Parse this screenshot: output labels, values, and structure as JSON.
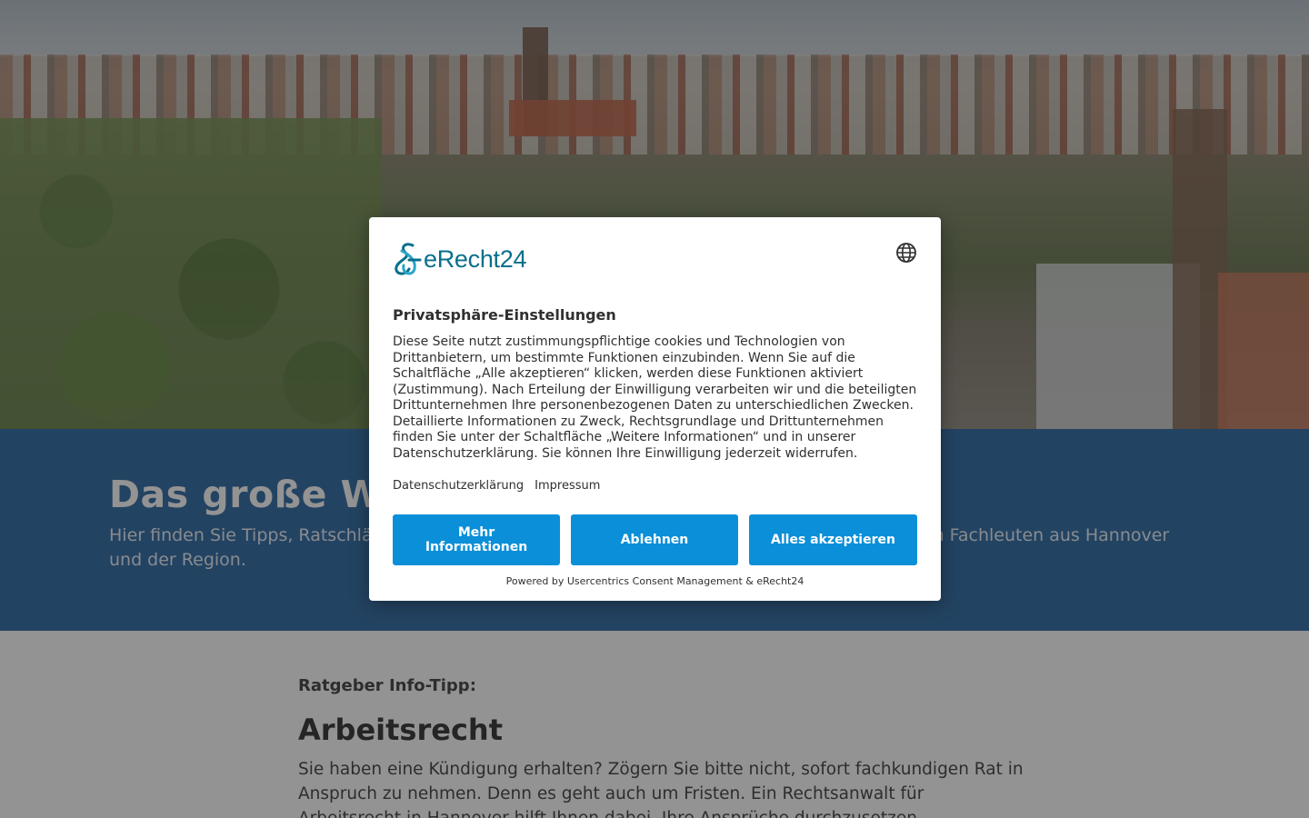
{
  "hero": {
    "image_description": "aerial city view"
  },
  "intro": {
    "title": "Das große W",
    "text": "Hier finden Sie Tipps, Ratschläge und Informationen von Anwälten, Steuerberatern und weiteren Fachleuten aus Hannover und der Region."
  },
  "content": {
    "tip_label": "Ratgeber Info-Tipp:",
    "article_title": "Arbeitsrecht",
    "article_text": "Sie haben eine Kündigung erhalten? Zögern Sie bitte nicht, sofort fachkundigen Rat in Anspruch zu nehmen. Denn es geht auch um Fristen. Ein Rechtsanwalt für Arbeitsrecht in Hannover hilft Ihnen dabei, Ihre Ansprüche durchzusetzen."
  },
  "consent": {
    "logo_text": "eRecht24",
    "language_icon": "globe-icon",
    "title": "Privatsphäre-Einstellungen",
    "body": "Diese Seite nutzt zustimmungspflichtige cookies und Technologien von Drittanbietern, um bestimmte Funktionen einzubinden. Wenn Sie auf die Schaltfläche „Alle akzeptieren“ klicken, werden diese Funktionen aktiviert (Zustimmung). Nach Erteilung der Einwilligung verarbeiten wir und die beteiligten Drittunternehmen Ihre personenbezogenen Daten zu unterschiedlichen Zwecken. Detaillierte Informationen zu Zweck, Rechtsgrundlage und Drittunternehmen finden Sie unter der Schaltfläche „Weitere Informationen“ und in unserer Datenschutzerklärung. Sie können Ihre Einwilligung jederzeit widerrufen.",
    "link_privacy": "Datenschutzerklärung",
    "link_imprint": "Impressum",
    "btn_more": "Mehr Informationen",
    "btn_decline": "Ablehnen",
    "btn_accept": "Alles akzeptieren",
    "powered_by": "Powered by Usercentrics Consent Management & eRecht24"
  },
  "colors": {
    "button": "#0b8fd8",
    "intro_band": "#1e5f9c",
    "logo": "#0a6f8c"
  }
}
